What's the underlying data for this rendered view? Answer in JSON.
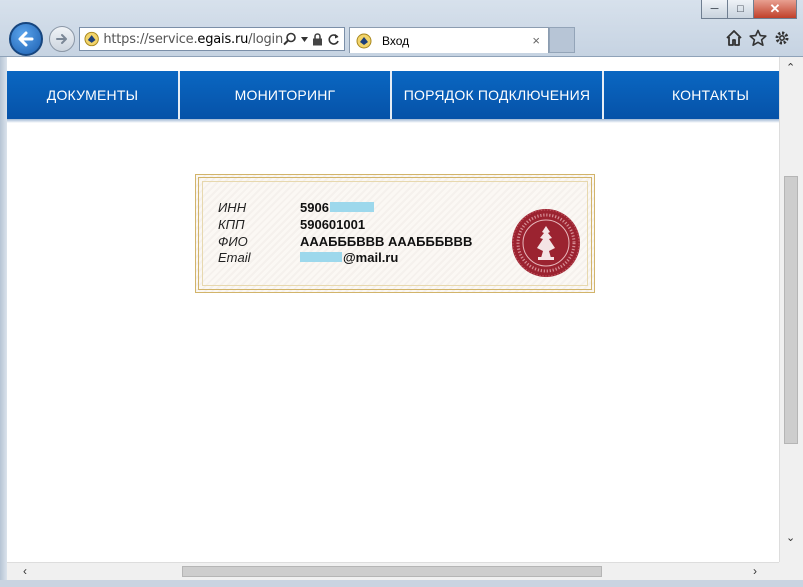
{
  "browser": {
    "url_prefix": "https://service.",
    "url_domain": "egais.ru",
    "url_path": "/login",
    "tab_title": "Вход",
    "tab_close": "×",
    "window_buttons": {
      "minimize": "─",
      "maximize": "□",
      "close": "✕"
    }
  },
  "nav": {
    "items": [
      {
        "label": "ДОКУМЕНТЫ"
      },
      {
        "label": "МОНИТОРИНГ"
      },
      {
        "label": "ПОРЯДОК ПОДКЛЮЧЕНИЯ"
      },
      {
        "label": "КОНТАКТЫ"
      }
    ]
  },
  "certificate": {
    "inn_label": "ИНН",
    "inn_value": "5906",
    "kpp_label": "КПП",
    "kpp_value": "590601001",
    "fio_label": "ФИО",
    "fio_value": "АААБББВВВ АААБББВВВ",
    "email_label": "Email",
    "email_value": "@mail.ru"
  },
  "colors": {
    "nav_blue": "#0652a8",
    "redaction": "#9dd8ec",
    "seal": "#9b2330",
    "cert_border": "#d2b46a"
  },
  "icons": [
    "back-arrow-icon",
    "forward-arrow-icon",
    "site-favicon-icon",
    "search-icon",
    "lock-icon",
    "refresh-icon",
    "home-icon",
    "favorites-star-icon",
    "settings-gear-icon",
    "seal-emblem-icon"
  ]
}
